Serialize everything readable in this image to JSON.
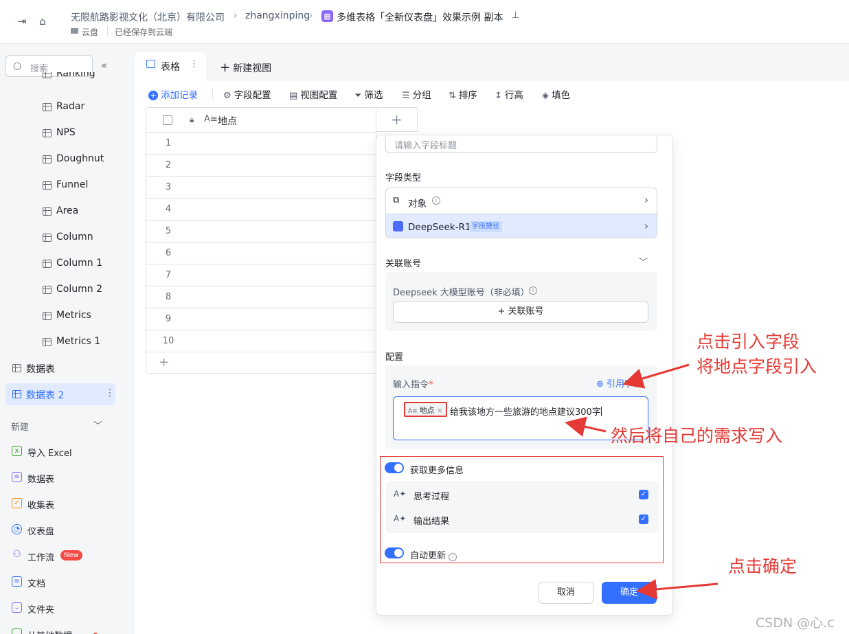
{
  "header": {
    "company": "无限航路影视文化（北京）有限公司",
    "user": "zhangxinping",
    "doc_title": "多维表格「全新仪表盘」效果示例 副本",
    "location": "云盘",
    "save_status": "已经保存到云端"
  },
  "sidebar": {
    "search_placeholder": "搜索",
    "items": [
      "Ranking",
      "Radar",
      "NPS",
      "Doughnut",
      "Funnel",
      "Area",
      "Column",
      "Column 1",
      "Column 2",
      "Metrics",
      "Metrics 1"
    ],
    "tables": [
      "数据表",
      "数据表 2"
    ],
    "new_section": "新建",
    "new_items": [
      {
        "label": "导入 Excel",
        "icon": "excel-icon",
        "color": "#2ea121"
      },
      {
        "label": "数据表",
        "icon": "table-icon",
        "color": "#8a63f7"
      },
      {
        "label": "收集表",
        "icon": "form-icon",
        "color": "#ff8800"
      },
      {
        "label": "仪表盘",
        "icon": "dashboard-icon",
        "color": "#3370ff"
      },
      {
        "label": "工作流",
        "icon": "workflow-icon",
        "color": "#8a63f7"
      },
      {
        "label": "文档",
        "icon": "doc-icon",
        "color": "#3370ff"
      },
      {
        "label": "文件夹",
        "icon": "folder-icon",
        "color": "#8a63f7"
      },
      {
        "label": "从其他数据…",
        "icon": "import-icon",
        "color": "#2ea121"
      }
    ],
    "new_badge": "New"
  },
  "view": {
    "tab_label": "表格",
    "new_view": "新建视图"
  },
  "toolbar": {
    "add_record": "添加记录",
    "field_config": "字段配置",
    "view_config": "视图配置",
    "filter": "筛选",
    "group": "分组",
    "sort": "排序",
    "row_height": "行高",
    "fill_color": "填色"
  },
  "grid": {
    "field_name": "地点",
    "rows": [
      "1",
      "2",
      "3",
      "4",
      "5",
      "6",
      "7",
      "8",
      "9",
      "10"
    ]
  },
  "panel": {
    "title_placeholder": "请输入字段标题",
    "field_type_label": "字段类型",
    "type_object": "对象",
    "type_deepseek": "DeepSeek-R1",
    "type_deepseek_tag": "字段捷径",
    "linked_account_label": "关联账号",
    "account_name": "Deepseek 大模型账号（非必填）",
    "link_account_button": "关联账号",
    "config_label": "配置",
    "prompt_label": "输入指令",
    "ref_field": "引用字段",
    "chip_label": "地点",
    "prompt_text": "给我该地方一些旅游的地点建议300字",
    "more_info": "获取更多信息",
    "think_process": "思考过程",
    "output_result": "输出结果",
    "auto_update": "自动更新",
    "cancel": "取消",
    "confirm": "确定"
  },
  "annotations": {
    "a1_line1": "点击引入字段",
    "a1_line2": "将地点字段引入",
    "a2": "然后将自己的需求写入",
    "a3": "点击确定"
  },
  "watermark": "CSDN @心.c",
  "colors": {
    "accent": "#3370ff",
    "annotation": "#e53935"
  }
}
